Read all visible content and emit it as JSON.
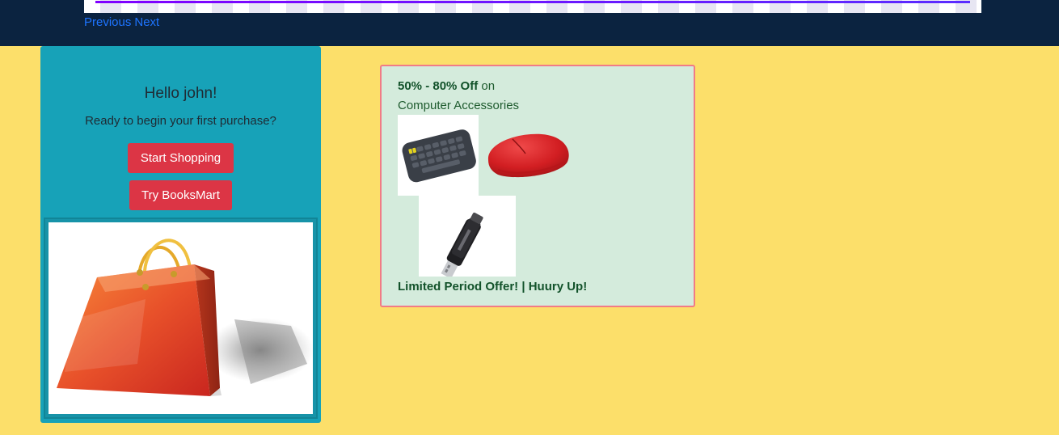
{
  "carousel": {
    "prev_label": "Previous",
    "next_label": "Next"
  },
  "welcome": {
    "title": "Hello john!",
    "subtitle": "Ready to begin your first purchase?",
    "start_button": "Start Shopping",
    "try_button": "Try BooksMart",
    "image_icon": "shopping-bag-icon"
  },
  "offer": {
    "discount": "50% - 80% Off",
    "on": "on",
    "category": "Computer Accessories",
    "footer": "Limited Period Offer! | Huury Up!",
    "images": [
      "keyboard-image",
      "mouse-image",
      "usb-drive-image"
    ]
  },
  "colors": {
    "page_bg": "#fcdf6a",
    "header_bg": "#0b2340",
    "card_bg": "#17a2b8",
    "button_red": "#dc3545",
    "offer_bg": "#d4ebdc",
    "offer_border": "#f17b86",
    "link_blue": "#1e74ff"
  }
}
